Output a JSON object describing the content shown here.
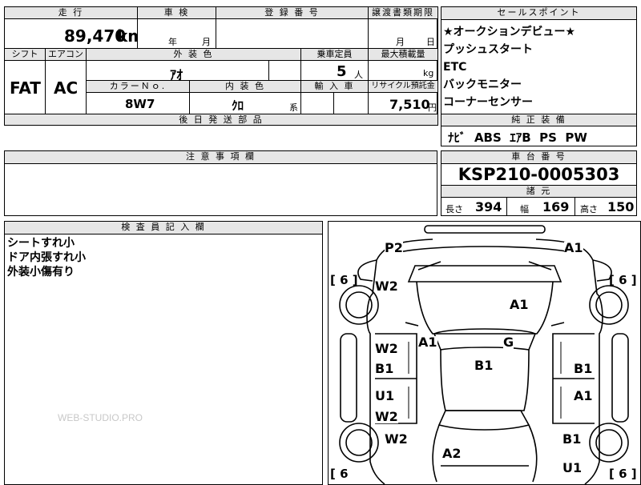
{
  "main": {
    "headers": {
      "mileage": "走 行",
      "inspection": "車 検",
      "registration": "登 録 番 号",
      "transfer_deadline": "譲渡書類期限",
      "shift": "シフト",
      "aircon": "エアコン",
      "exterior_color": "外 装 色",
      "capacity": "乗車定員",
      "max_load": "最大積載量",
      "color_no": "カラーＮｏ.",
      "interior_color": "内 装 色",
      "import": "輸 入 車",
      "recycle": "リサイクル預託金",
      "later_parts": "後 日 発 送 部 品"
    },
    "mileage_value": "89,470",
    "mileage_unit": "km",
    "year_label": "年",
    "month_label": "月",
    "deadline_month": "月",
    "deadline_day": "日",
    "shift_value": "FAT",
    "aircon_value": "AC",
    "exterior_color_value": "ｱｵ",
    "capacity_value": "5",
    "capacity_unit": "人",
    "load_unit": "kg",
    "color_no_value": "8W7",
    "interior_color_value": "ｸﾛ",
    "interior_color_suffix": "系",
    "recycle_value": "7,510",
    "recycle_unit": "円"
  },
  "sales": {
    "header": "セールスポイント",
    "points": [
      "★オークションデビュー★",
      "プッシュスタート",
      "ETC",
      "バックモニター",
      "コーナーセンサー"
    ],
    "equipment_header": "純 正 装 備",
    "equipment_value": "ﾅﾋﾞ  ABS  ｴｱB  PS  PW"
  },
  "notes": {
    "header": "注 意 事 項 欄"
  },
  "chassis": {
    "header": "車 台 番 号",
    "value": "KSP210-0005303",
    "specs_header": "諸 元",
    "length_label": "長さ",
    "length_value": "394",
    "width_label": "幅",
    "width_value": "169",
    "height_label": "高さ",
    "height_value": "150"
  },
  "inspector": {
    "header": "検 査 員 記 入 欄",
    "lines": [
      "シートすれ小",
      "ドア内張すれ小",
      "外装小傷有り"
    ],
    "watermark": "WEB-STUDIO.PRO"
  },
  "diagram": {
    "marks": {
      "p2": "P2",
      "a1_front": "A1",
      "w2_left_front": "W2",
      "a1_hood": "A1",
      "a1_left_pillar": "A1",
      "g": "G",
      "w2_left_door": "W2",
      "b1_left": "B1",
      "b1_roof": "B1",
      "b1_right": "B1",
      "u1_left": "U1",
      "a1_right_rear": "A1",
      "w2_left_rear": "W2",
      "w2_left_rear2": "W2",
      "b1_right_rear": "B1",
      "a2_trunk": "A2",
      "u1_rear": "U1"
    },
    "tire_left_front": "[ 6 ]",
    "tire_right_front": "[ 6 ]",
    "tire_left_rear": "[ 6",
    "tire_right_rear": "[ 6 ]"
  }
}
